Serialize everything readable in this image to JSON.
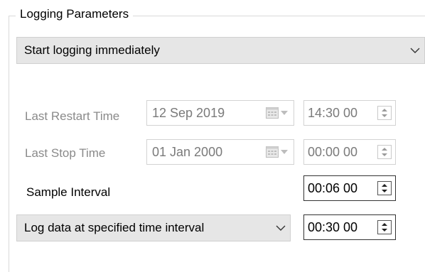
{
  "group": {
    "title": "Logging Parameters"
  },
  "start_mode": {
    "value": "Start logging immediately",
    "icon": "chevron-down-icon"
  },
  "last_restart": {
    "label": "Last Restart Time",
    "date": "12 Sep 2019",
    "time": "14:30 00"
  },
  "last_stop": {
    "label": "Last Stop Time",
    "date": "01 Jan 2000",
    "time": "00:00 00"
  },
  "sample_interval": {
    "label": "Sample Interval",
    "time": "00:06 00"
  },
  "log_mode": {
    "value": "Log data at specified time interval",
    "time": "00:30 00",
    "icon": "chevron-down-icon"
  },
  "icons": {
    "calendar": "calendar-icon",
    "spin": "spin-up-down-icon"
  }
}
